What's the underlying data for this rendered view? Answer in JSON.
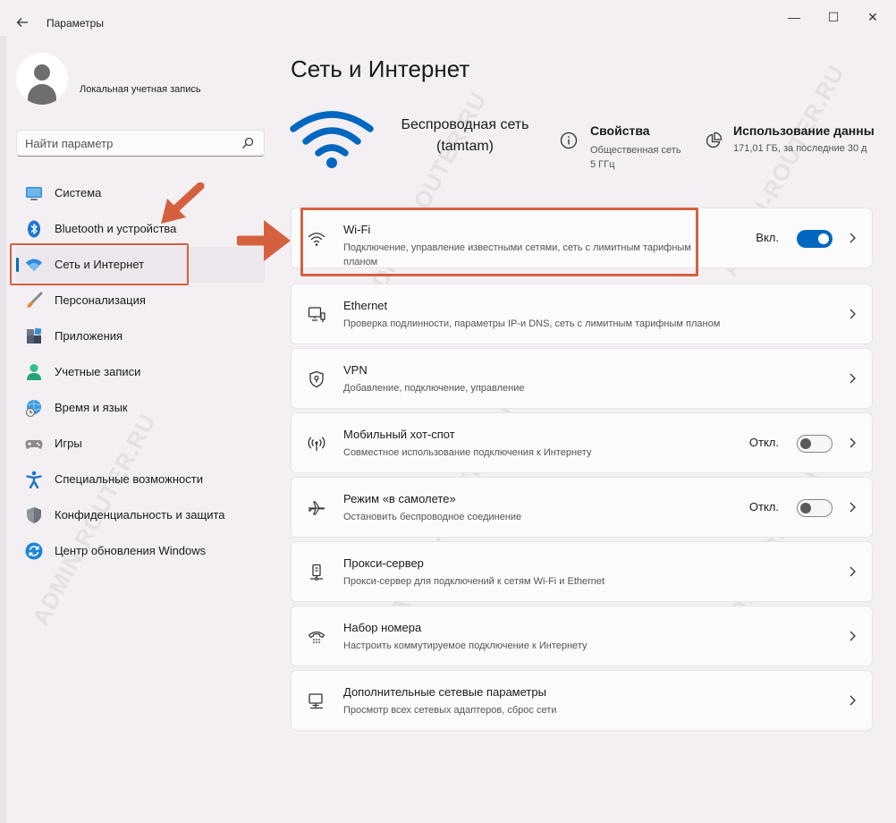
{
  "titlebar": {
    "back_icon": "arrow-left-icon",
    "title": "Параметры",
    "minimize": "—",
    "maximize": "☐",
    "close": "✕"
  },
  "sidebar": {
    "account_name": "Локальная учетная запись",
    "search_placeholder": "Найти параметр",
    "items": [
      {
        "label": "Система",
        "icon": "system-monitor-icon",
        "active": false
      },
      {
        "label": "Bluetooth и устройства",
        "icon": "bluetooth-icon",
        "active": false
      },
      {
        "label": "Сеть и Интернет",
        "icon": "wifi-icon",
        "active": true
      },
      {
        "label": "Персонализация",
        "icon": "brush-icon",
        "active": false
      },
      {
        "label": "Приложения",
        "icon": "apps-icon",
        "active": false
      },
      {
        "label": "Учетные записи",
        "icon": "person-icon",
        "active": false
      },
      {
        "label": "Время и язык",
        "icon": "globe-clock-icon",
        "active": false
      },
      {
        "label": "Игры",
        "icon": "gamepad-icon",
        "active": false
      },
      {
        "label": "Специальные возможности",
        "icon": "accessibility-icon",
        "active": false
      },
      {
        "label": "Конфиденциальность и защита",
        "icon": "shield-icon",
        "active": false
      },
      {
        "label": "Центр обновления Windows",
        "icon": "update-icon",
        "active": false
      }
    ]
  },
  "main": {
    "title": "Сеть и Интернет",
    "network": {
      "name_line1": "Беспроводная сеть",
      "name_line2": "(tamtam)",
      "properties_title": "Свойства",
      "properties_line1": "Общественная сеть",
      "properties_line2": "5 ГГц",
      "usage_title": "Использование данны",
      "usage_sub": "171,01 ГБ, за последние 30 д"
    },
    "cards": [
      {
        "title": "Wi-Fi",
        "desc": "Подключение, управление известными сетями, сеть с лимитным тарифным планом",
        "icon": "wifi-icon",
        "toggle": "Вкл.",
        "toggle_on": true
      },
      {
        "title": "Ethernet",
        "desc": "Проверка подлинности, параметры IP-и DNS, сеть с лимитным тарифным планом",
        "icon": "ethernet-icon"
      },
      {
        "title": "VPN",
        "desc": "Добавление, подключение, управление",
        "icon": "vpn-shield-icon"
      },
      {
        "title": "Мобильный хот-спот",
        "desc": "Совместное использование подключения к Интернету",
        "icon": "hotspot-icon",
        "toggle": "Откл.",
        "toggle_on": false
      },
      {
        "title": "Режим «в самолете»",
        "desc": "Остановить беспроводное соединение",
        "icon": "airplane-icon",
        "toggle": "Откл.",
        "toggle_on": false
      },
      {
        "title": "Прокси-сервер",
        "desc": "Прокси-сервер для подключений к сетям Wi-Fi и Ethernet",
        "icon": "proxy-icon"
      },
      {
        "title": "Набор номера",
        "desc": "Настроить коммутируемое подключение к Интернету",
        "icon": "dialup-icon"
      },
      {
        "title": "Дополнительные сетевые параметры",
        "desc": "Просмотр всех сетевых адаптеров, сброс сети",
        "icon": "network-computer-icon"
      }
    ]
  },
  "colors": {
    "accent": "#0067c0",
    "annotation": "#d5603e",
    "window_bg": "#f3eff3",
    "card_bg": "#fbfbfb"
  },
  "watermark": "ADMIN-ROUTER.RU"
}
